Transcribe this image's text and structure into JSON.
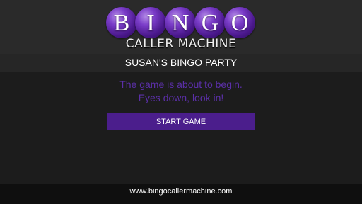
{
  "logo": {
    "letters": [
      "B",
      "I",
      "N",
      "G",
      "O"
    ],
    "subtitle": "CALLER MACHINE",
    "ball_color": "#6a2bb8"
  },
  "party": {
    "title": "SUSAN'S BINGO PARTY"
  },
  "message": {
    "line1": "The game is about to begin.",
    "line2": "Eyes down, look in!"
  },
  "actions": {
    "start_label": "START GAME",
    "accent": "#4b1e8c"
  },
  "footer": {
    "url": "www.bingocallermachine.com"
  }
}
